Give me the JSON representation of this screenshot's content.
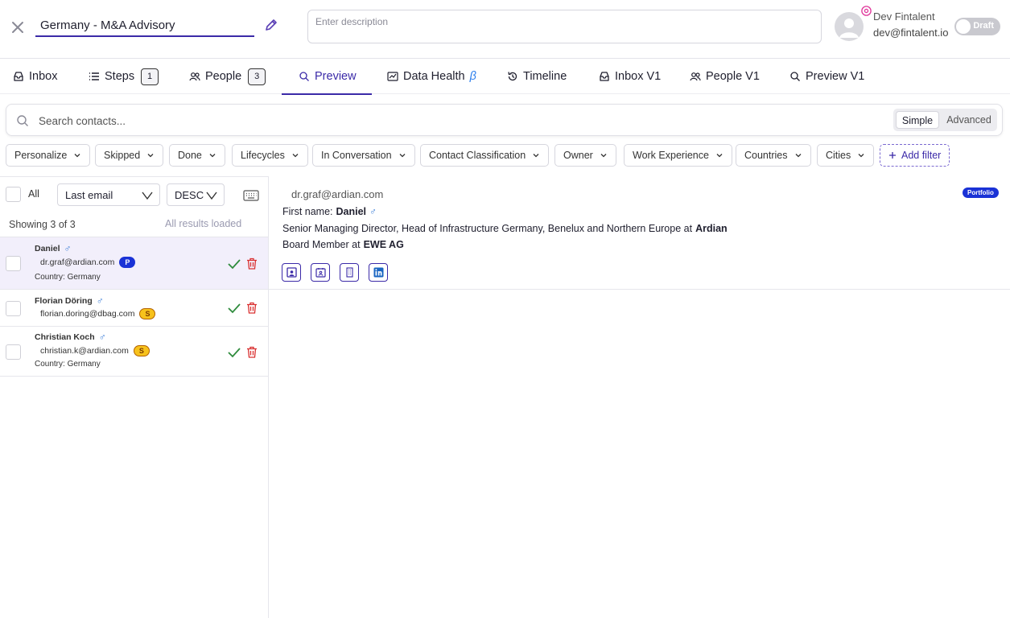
{
  "header": {
    "campaign_title": "Germany - M&A Advisory",
    "description_placeholder": "Enter description",
    "user_name": "Dev Fintalent",
    "user_email": "dev@fintalent.io",
    "status_toggle": "Draft"
  },
  "tabs": [
    {
      "label": "Inbox",
      "icon": "inbox-icon"
    },
    {
      "label": "Steps",
      "icon": "list-icon",
      "count": "1"
    },
    {
      "label": "People",
      "icon": "people-icon",
      "count": "3"
    },
    {
      "label": "Preview",
      "icon": "search-icon",
      "active": true
    },
    {
      "label": "Data Health",
      "icon": "chart-icon",
      "suffix": "β"
    },
    {
      "label": "Timeline",
      "icon": "history-icon"
    },
    {
      "label": "Inbox V1",
      "icon": "inbox-icon"
    },
    {
      "label": "People V1",
      "icon": "people-icon"
    },
    {
      "label": "Preview V1",
      "icon": "search-icon"
    }
  ],
  "search": {
    "placeholder": "Search contacts...",
    "mode_simple": "Simple",
    "mode_advanced": "Advanced",
    "active_mode": "Simple"
  },
  "filters": [
    "Personalize",
    "Skipped",
    "Done",
    "Lifecycles",
    "In Conversation",
    "Contact Classification",
    "Owner",
    "Work Experience",
    "Countries",
    "Cities"
  ],
  "add_filter_label": "Add filter",
  "list": {
    "select_all_label": "All",
    "sort_field": "Last email",
    "sort_direction": "DESC",
    "showing_text": "Showing 3 of 3",
    "loaded_text": "All results loaded",
    "contacts": [
      {
        "name": "Daniel",
        "gender": "♂",
        "email": "dr.graf@ardian.com",
        "tag": "P",
        "country": "Country: Germany",
        "selected": true
      },
      {
        "name": "Florian Döring",
        "gender": "♂",
        "email": "florian.doring@dbag.com",
        "tag": "S",
        "country": ""
      },
      {
        "name": "Christian Koch",
        "gender": "♂",
        "email": "christian.k@ardian.com",
        "tag": "S",
        "country": "Country: Germany"
      }
    ]
  },
  "detail": {
    "email": "dr.graf@ardian.com",
    "badge": "Portfolio",
    "first_name_label": "First name:",
    "first_name": "Daniel",
    "gender": "♂",
    "position_1_text": "Senior Managing Director, Head of Infrastructure Germany, Benelux and Northern Europe at",
    "position_1_company": "Ardian",
    "position_2_text": "Board Member at",
    "position_2_company": "EWE AG",
    "link_icons": [
      "profile-card-icon",
      "contact-card-icon",
      "building-icon",
      "linkedin-icon"
    ]
  },
  "colors": {
    "accent": "#3b2aa8",
    "portfolio_badge": "#1a32d6",
    "secondary_badge": "#f7c21c",
    "check": "#2e8b3c",
    "delete": "#d93030",
    "selected_row": "#f2effb"
  }
}
